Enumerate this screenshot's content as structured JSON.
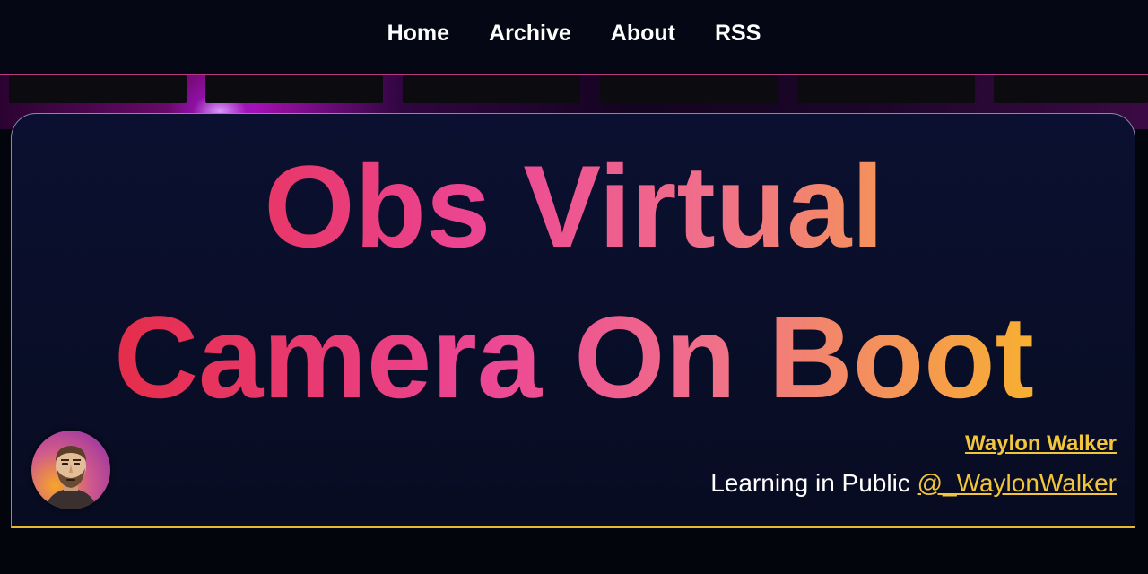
{
  "nav": {
    "items": [
      {
        "label": "Home"
      },
      {
        "label": "Archive"
      },
      {
        "label": "About"
      },
      {
        "label": "RSS"
      }
    ]
  },
  "post": {
    "title_line_1": "Obs Virtual",
    "title_line_2": "Camera On Boot"
  },
  "author": {
    "name": "Waylon Walker",
    "tagline": "Learning in Public ",
    "handle": "@_WaylonWalker",
    "avatar_icon": "author-avatar-illustration"
  },
  "colors": {
    "accent_yellow": "#f2c53a",
    "title_gradient": [
      "#e42c46",
      "#ec4694",
      "#f0708a",
      "#f8b42a"
    ],
    "nav_border": "#b83a7e"
  }
}
